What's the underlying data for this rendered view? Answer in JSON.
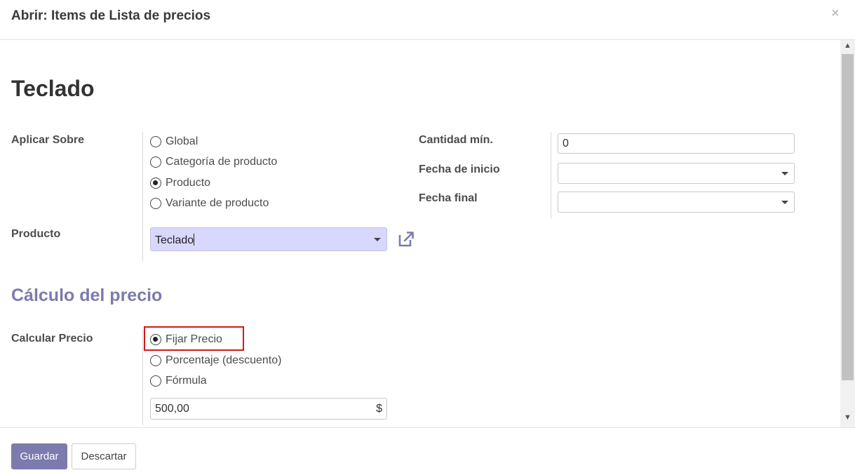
{
  "dialog": {
    "title": "Abrir: Items de Lista de precios",
    "close_glyph": "×"
  },
  "record": {
    "title": "Teclado"
  },
  "apply_on": {
    "label": "Aplicar Sobre",
    "options": [
      "Global",
      "Categoría de producto",
      "Producto",
      "Variante de producto"
    ],
    "selected": "Producto"
  },
  "product": {
    "label": "Producto",
    "value": "Teclado",
    "external_link_icon": "external-link-icon"
  },
  "min_qty": {
    "label": "Cantidad mín.",
    "value": "0"
  },
  "date_start": {
    "label": "Fecha de inicio",
    "value": ""
  },
  "date_end": {
    "label": "Fecha final",
    "value": ""
  },
  "price_section": {
    "title": "Cálculo del precio"
  },
  "compute_price": {
    "label": "Calcular Precio",
    "options": [
      "Fijar Precio",
      "Porcentaje (descuento)",
      "Fórmula"
    ],
    "selected": "Fijar Precio"
  },
  "fixed_price": {
    "value": "500,00",
    "currency": "$"
  },
  "footer": {
    "save_label": "Guardar",
    "discard_label": "Descartar"
  },
  "colors": {
    "accent": "#7c7bad",
    "product_highlight": "#d8d8ff",
    "annotation_box": "#d11a1a"
  }
}
